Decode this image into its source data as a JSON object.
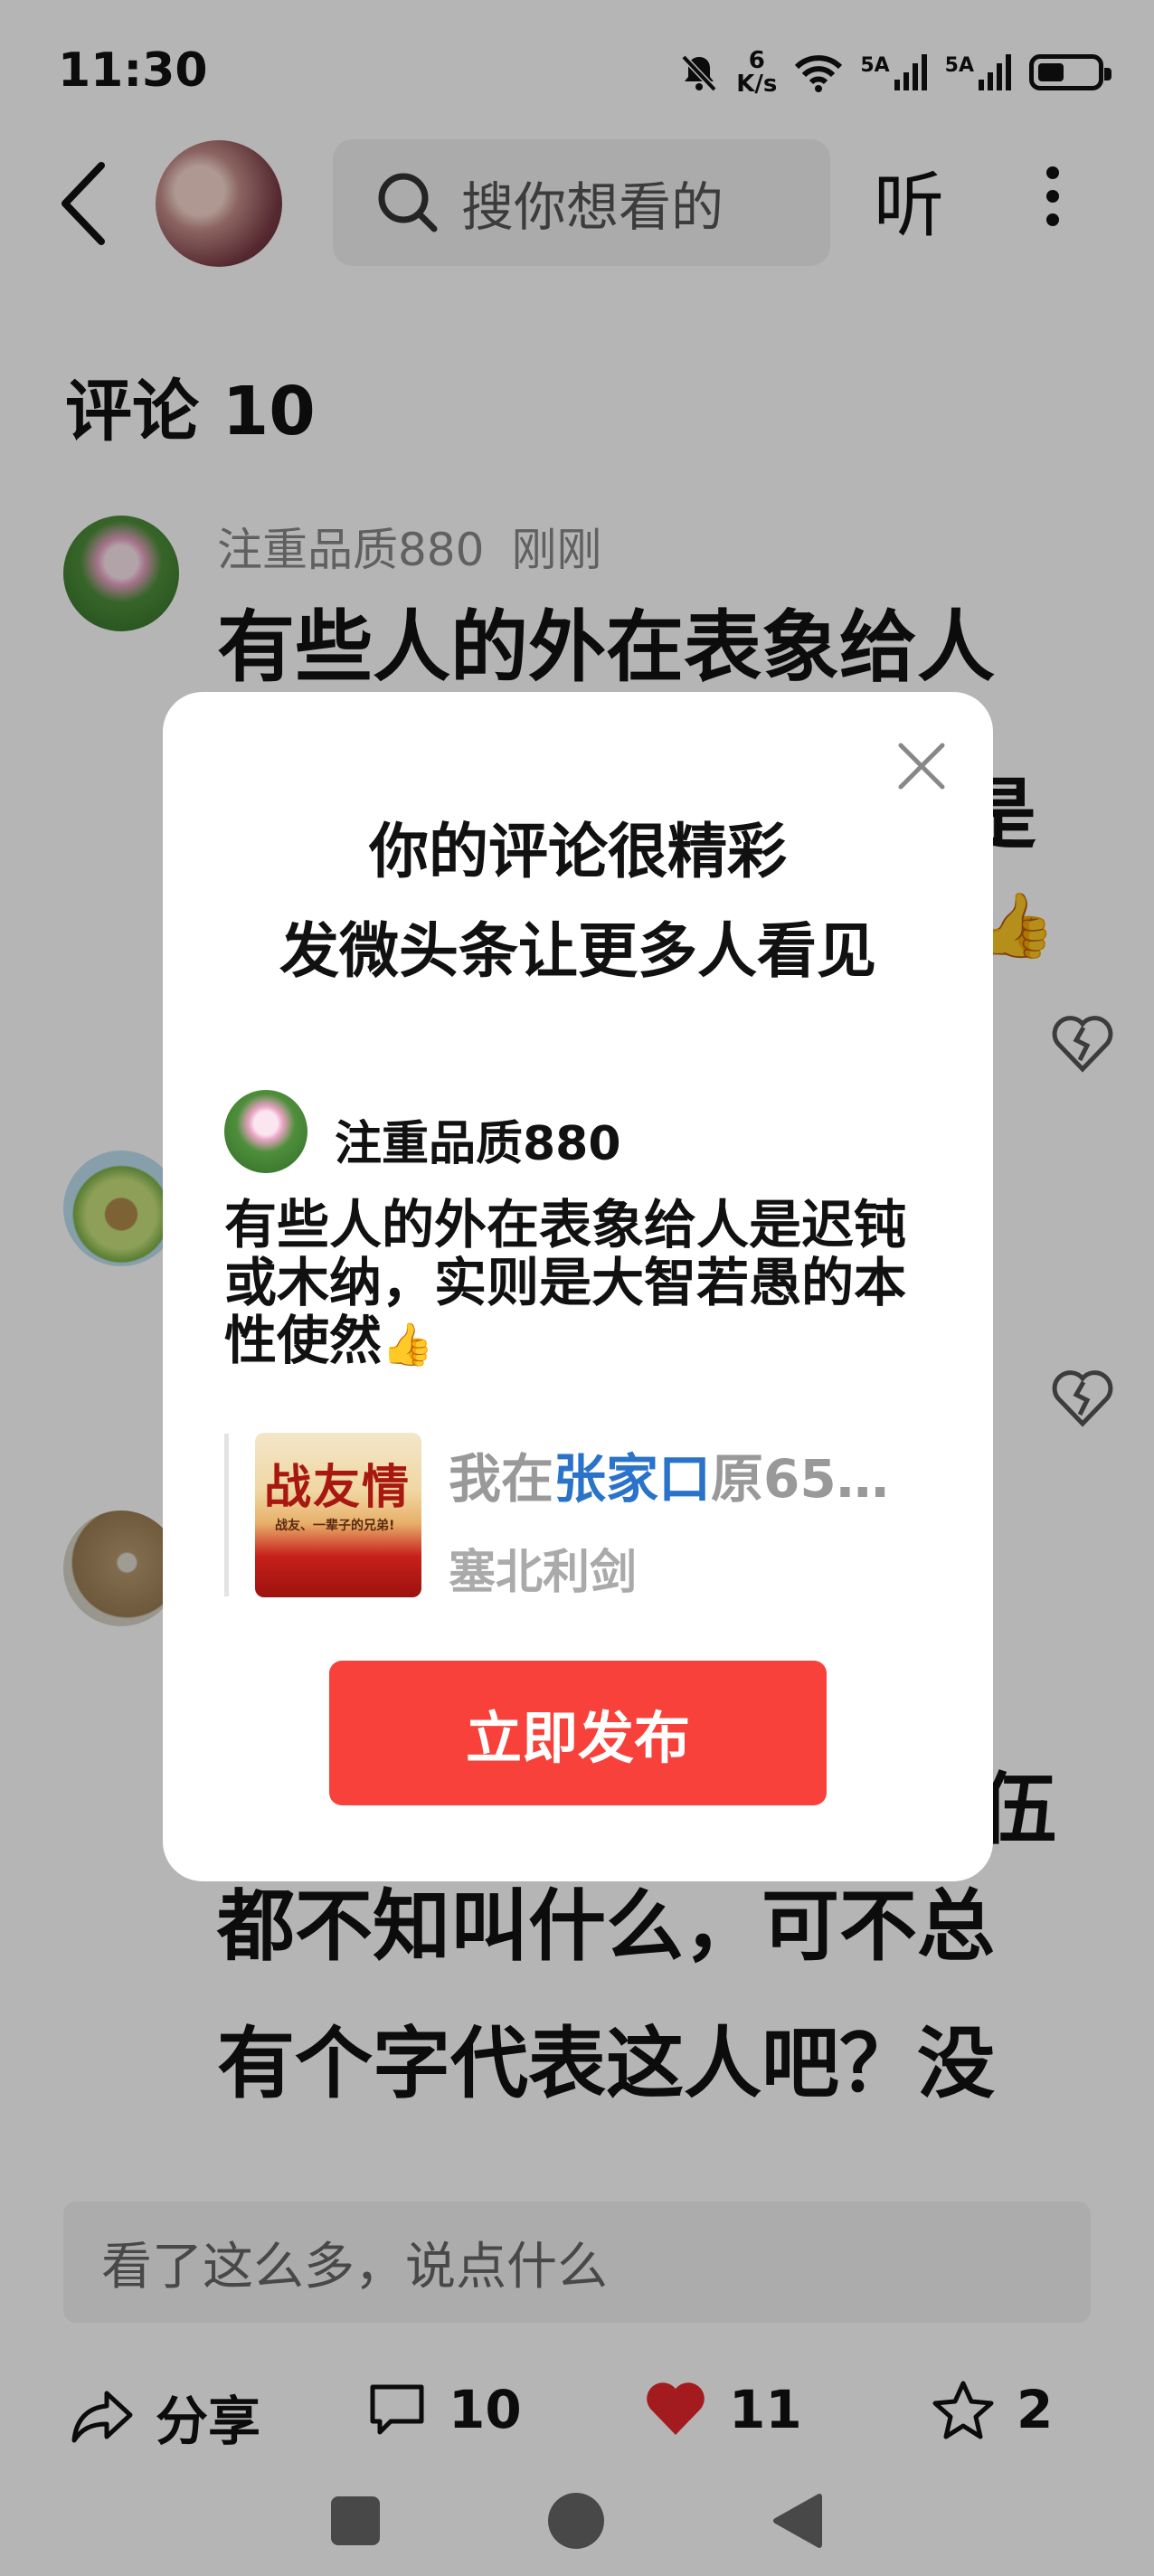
{
  "status_bar": {
    "time": "11:30",
    "net_speed_value": "6",
    "net_speed_unit": "K/s",
    "signal_1_label": "5A",
    "signal_2_label": "5A",
    "icons": [
      "mute-bell-icon",
      "wifi-icon",
      "signal-icon",
      "signal-icon",
      "battery-icon"
    ],
    "battery_level": 0.45
  },
  "header": {
    "search_placeholder": "搜你想看的",
    "listen_label": "听",
    "icons": [
      "back-icon",
      "search-icon",
      "more-icon"
    ]
  },
  "comments_section": {
    "title": "评论 10",
    "comments": [
      {
        "author": "注重品质880",
        "time": "刚刚",
        "lines": [
          "有些人的外在表象给人",
          "",
          "",
          "",
          ""
        ]
      },
      {
        "lines": [
          "",
          "",
          "伍",
          "都不知叫什么，可不总",
          "有个字代表这人吧？没"
        ]
      }
    ],
    "partial_fragments": [
      "是"
    ]
  },
  "dialog": {
    "title_line1": "你的评论很精彩",
    "title_line2": "发微头条让更多人看见",
    "author": "注重品质880",
    "comment_text": "有些人的外在表象给人是迟钝或木纳，实则是大智若愚的本性使然",
    "comment_emoji": "👍",
    "article_title_prefix": "我在",
    "article_title_highlight": "张家口",
    "article_title_suffix": "原65…",
    "article_source": "塞北利剑",
    "thumb_text_main": "战友情",
    "thumb_text_sub": "战友、一辈子的兄弟!",
    "publish_label": "立即发布"
  },
  "bottom_bar": {
    "input_placeholder": "看了这么多，说点什么",
    "share_label": "分享",
    "comment_count": "10",
    "like_count": "11",
    "favorite_count": "2",
    "like_color": "#e8262d"
  }
}
